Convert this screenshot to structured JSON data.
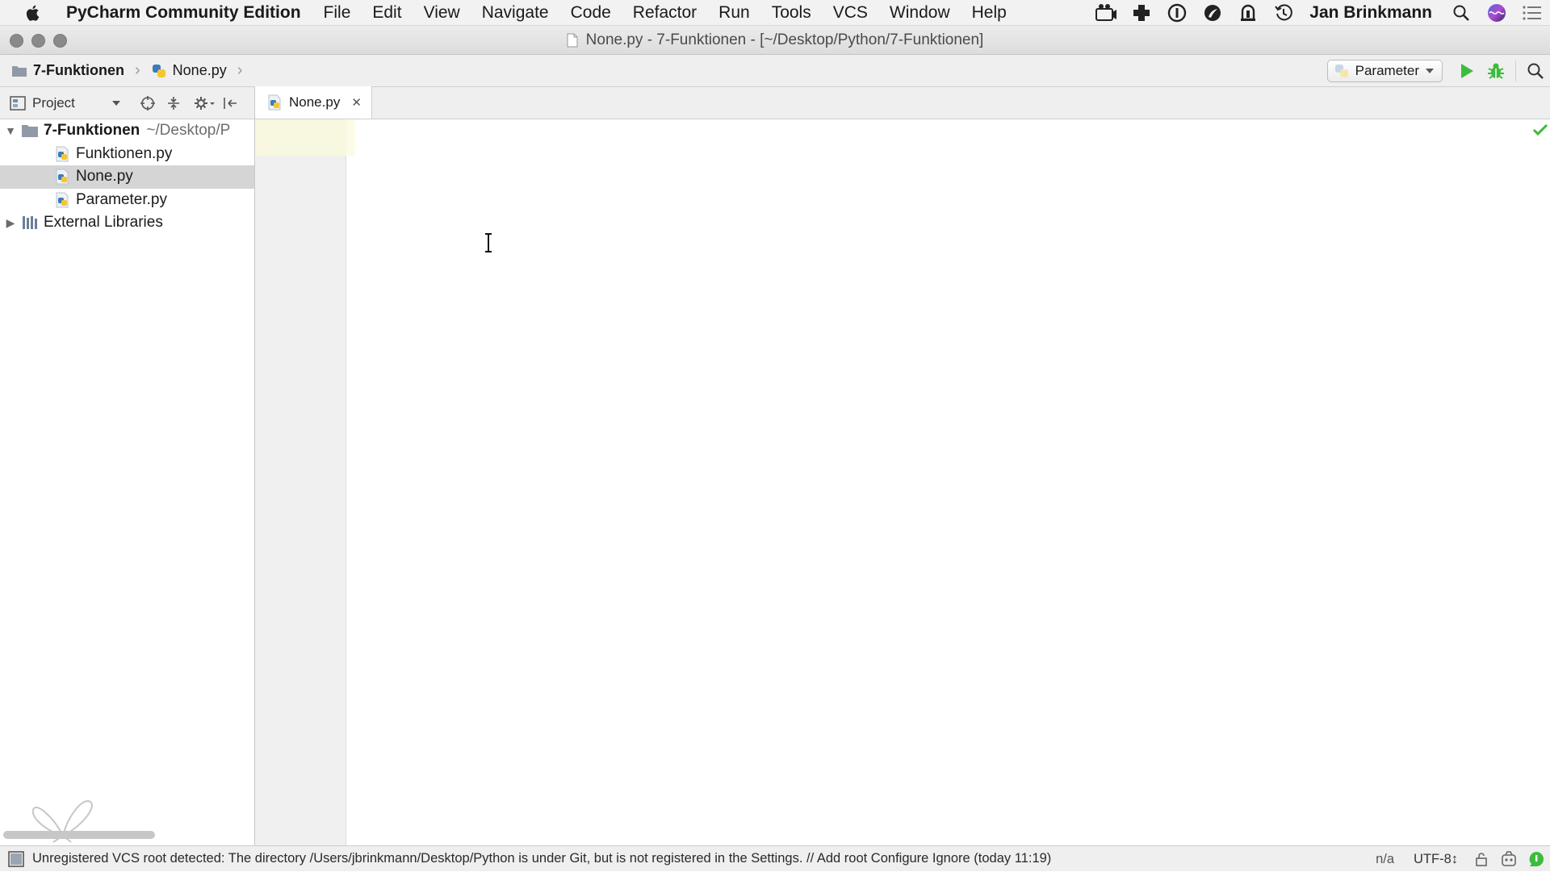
{
  "menubar": {
    "app_name": "PyCharm Community Edition",
    "menus": [
      "File",
      "Edit",
      "View",
      "Navigate",
      "Code",
      "Refactor",
      "Run",
      "Tools",
      "VCS",
      "Window",
      "Help"
    ],
    "user": "Jan Brinkmann"
  },
  "window": {
    "title": "None.py - 7-Funktionen - [~/Desktop/Python/7-Funktionen]"
  },
  "navbar": {
    "crumbs": [
      "7-Funktionen",
      "None.py"
    ],
    "run_config": "Parameter"
  },
  "project": {
    "view_label": "Project",
    "root_name": "7-Funktionen",
    "root_path": "~/Desktop/P",
    "files": [
      "Funktionen.py",
      "None.py",
      "Parameter.py"
    ],
    "selected_file": "None.py",
    "external": "External Libraries"
  },
  "editor": {
    "tab_label": "None.py"
  },
  "statusbar": {
    "message": "Unregistered VCS root detected: The directory /Users/jbrinkmann/Desktop/Python is under Git, but is not registered in the Settings. // Add root  Configure  Ignore (today 11:19)",
    "position": "n/a",
    "encoding": "UTF-8↕"
  },
  "colors": {
    "run_green": "#3dbb3d",
    "python_blue": "#3d7ab8",
    "python_yellow": "#f2c832",
    "selection": "#d5d5d5"
  }
}
